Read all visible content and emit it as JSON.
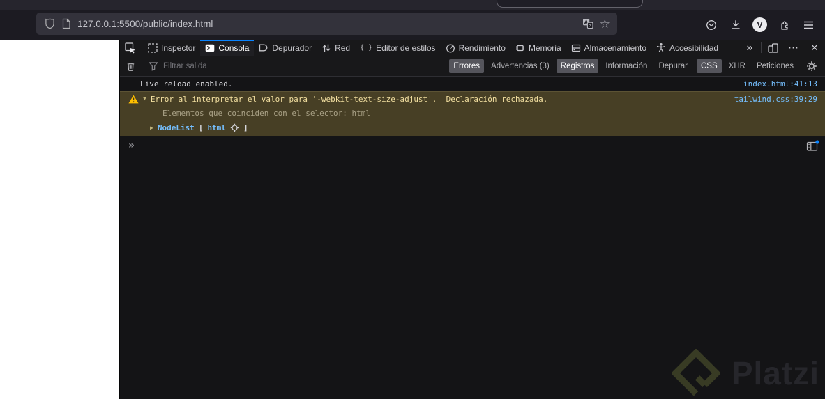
{
  "colors": {
    "accent": "#0a84ff",
    "link": "#75bfff",
    "warnbg": "#473f25",
    "warnborder": "#5c5334",
    "warntext": "#f2dfa0",
    "warnicon": "#ffbf00"
  },
  "browser": {
    "url": "127.0.0.1:5500/public/index.html",
    "avatar_letter": "V"
  },
  "devtools": {
    "tabs": [
      {
        "label": "Inspector",
        "active": false
      },
      {
        "label": "Consola",
        "active": true
      },
      {
        "label": "Depurador",
        "active": false
      },
      {
        "label": "Red",
        "active": false
      },
      {
        "label": "Editor de estilos",
        "active": false
      },
      {
        "label": "Rendimiento",
        "active": false
      },
      {
        "label": "Memoria",
        "active": false
      },
      {
        "label": "Almacenamiento",
        "active": false
      },
      {
        "label": "Accesibilidad",
        "active": false
      }
    ],
    "filter": {
      "placeholder": "Filtrar salida",
      "buttons": [
        {
          "label": "Errores",
          "active": true
        },
        {
          "label": "Advertencias (3)",
          "active": false
        },
        {
          "label": "Registros",
          "active": true
        },
        {
          "label": "Información",
          "active": false
        },
        {
          "label": "Depurar",
          "active": false
        },
        {
          "label": "CSS",
          "active": true
        },
        {
          "label": "XHR",
          "active": false
        },
        {
          "label": "Peticiones",
          "active": false
        }
      ]
    },
    "console": {
      "log_message": "Live reload enabled.",
      "log_source": "index.html:41:13",
      "warning_message": "Error al interpretar el valor para '-webkit-text-size-adjust'.  Declaración rechazada.",
      "warning_source": "tailwind.css:39:29",
      "warning_detail": "Elementos que coinciden con el selector: html",
      "result_class": "NodeList",
      "result_bracket_open": "[",
      "result_item": "html",
      "result_bracket_close": "]",
      "prompt": "»"
    },
    "watermark": "Platzi"
  },
  "glyphs": {
    "star": "☆",
    "more_tabs": "»",
    "meatball": "⋯",
    "close": "✕",
    "braces": "{ }",
    "twisty_open": "▼",
    "twisty_closed": "▶"
  }
}
